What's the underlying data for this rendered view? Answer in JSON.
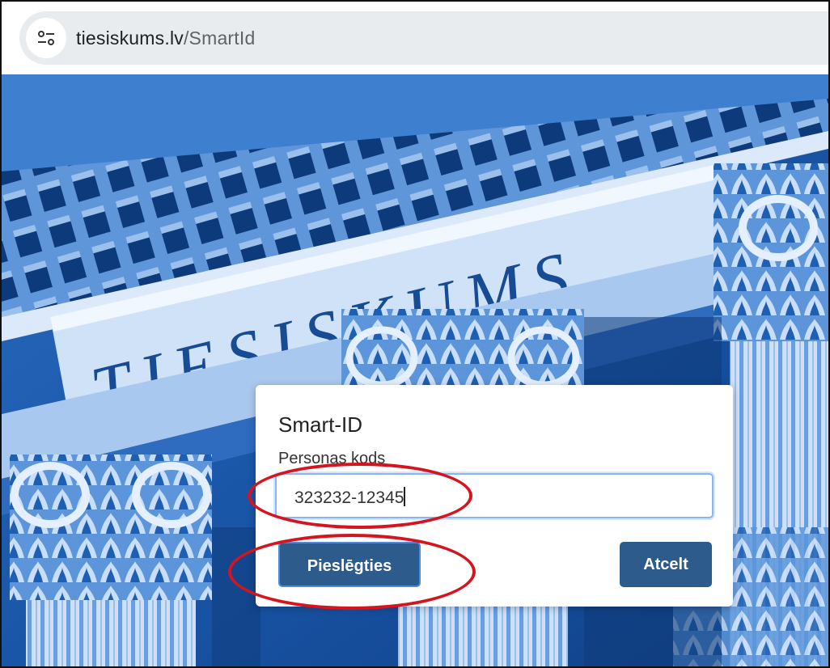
{
  "browser": {
    "url_host": "tiesiskums.lv",
    "url_path": "/SmartId",
    "site_settings_icon": "tune-icon"
  },
  "hero": {
    "inscription": "TIESISKUMS",
    "tint_color": "#1d5fb3"
  },
  "login_dialog": {
    "title": "Smart-ID",
    "field_label": "Personas kods",
    "field_value": "323232-12345",
    "login_button": "Pieslēgties",
    "cancel_button": "Atcelt",
    "button_color": "#2d5b8c"
  },
  "annotations": {
    "highlight_color": "#d6141d"
  }
}
